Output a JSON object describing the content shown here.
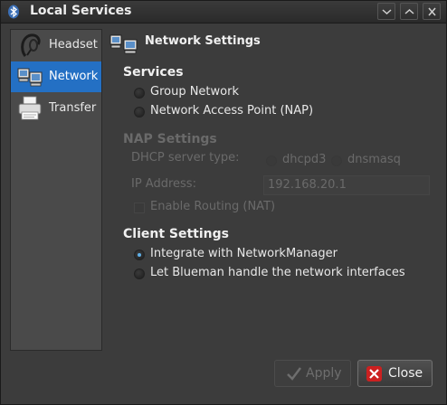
{
  "window": {
    "title": "Local Services",
    "title_icon": "bluetooth-icon",
    "controls": [
      "chevron-down-icon",
      "chevron-up-icon",
      "close-icon"
    ]
  },
  "sidebar": {
    "items": [
      {
        "label": "Headset",
        "icon": "headset-icon",
        "selected": false
      },
      {
        "label": "Network",
        "icon": "network-icon",
        "selected": true
      },
      {
        "label": "Transfer",
        "icon": "printer-icon",
        "selected": false
      }
    ]
  },
  "content": {
    "header": "Network Settings",
    "services": {
      "title": "Services",
      "options": [
        "Group Network",
        "Network Access Point (NAP)"
      ]
    },
    "nap": {
      "title": "NAP Settings",
      "dhcp_label": "DHCP server type:",
      "dhcp_options": [
        "dhcpd3",
        "dnsmasq"
      ],
      "ip_label": "IP Address:",
      "ip_value": "192.168.20.1",
      "routing_label": "Enable Routing (NAT)"
    },
    "client": {
      "title": "Client Settings",
      "options": [
        "Integrate with NetworkManager",
        "Let Blueman handle the network interfaces"
      ],
      "selected": "Integrate with NetworkManager"
    }
  },
  "buttons": {
    "apply": "Apply",
    "close": "Close"
  },
  "colors": {
    "accent": "#2470c4",
    "background": "#3c3c3c"
  }
}
